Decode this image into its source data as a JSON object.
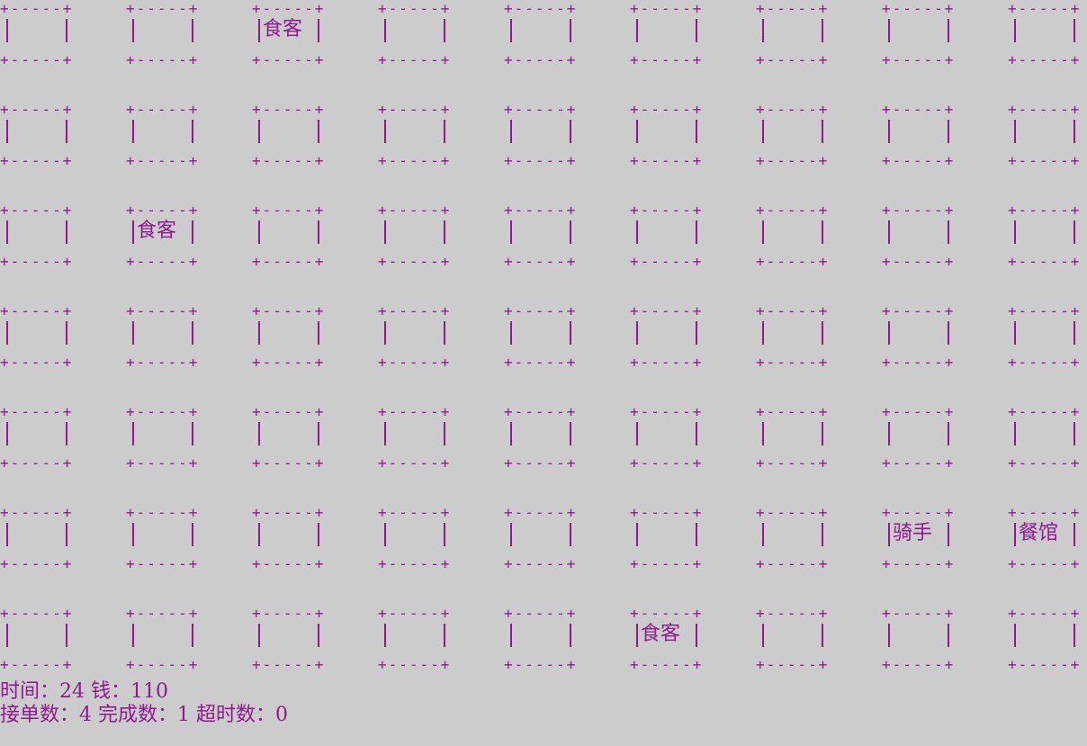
{
  "grid": {
    "rows": 7,
    "cols": 9,
    "border_top": "+-----+",
    "border_bottom": "+-----+",
    "cells": [
      [
        "",
        "",
        "食客",
        "",
        "",
        "",
        "",
        "",
        ""
      ],
      [
        "",
        "",
        "",
        "",
        "",
        "",
        "",
        "",
        ""
      ],
      [
        "",
        "食客",
        "",
        "",
        "",
        "",
        "",
        "",
        ""
      ],
      [
        "",
        "",
        "",
        "",
        "",
        "",
        "",
        "",
        ""
      ],
      [
        "",
        "",
        "",
        "",
        "",
        "",
        "",
        "",
        ""
      ],
      [
        "",
        "",
        "",
        "",
        "",
        "",
        "",
        "骑手",
        "餐馆"
      ],
      [
        "",
        "",
        "",
        "",
        "",
        "食客",
        "",
        "",
        ""
      ]
    ]
  },
  "status": {
    "line1": "时间：24 钱：110",
    "line2": "接单数：4 完成数：1 超时数：0"
  },
  "colors": {
    "background": "#cccccc",
    "text": "#8e1a8e"
  }
}
